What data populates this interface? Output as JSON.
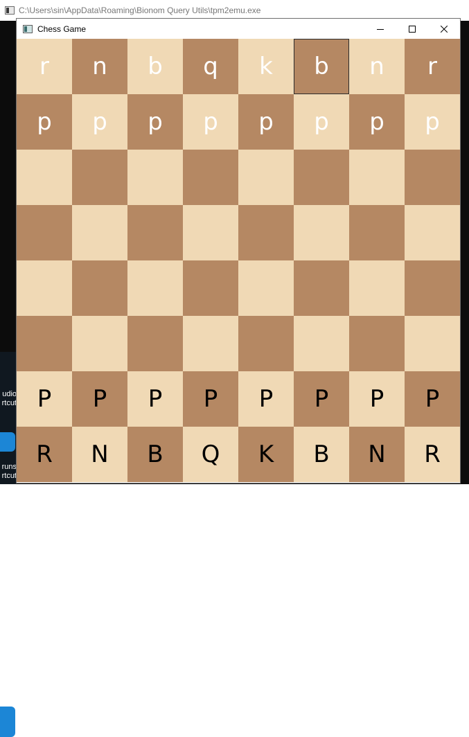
{
  "console": {
    "title": "C:\\Users\\sin\\AppData\\Roaming\\Bionom Query Utils\\tpm2emu.exe"
  },
  "desktop": {
    "icons": [
      {
        "label_line1": "udio",
        "label_line2": "rtcut"
      },
      {
        "label_line1": "runs",
        "label_line2": "rtcut"
      }
    ]
  },
  "window": {
    "title": "Chess Game",
    "icon": "window-app-icon",
    "buttons": {
      "minimize": "minimize-icon",
      "maximize": "maximize-icon",
      "close": "close-icon"
    }
  },
  "board": {
    "light_color": "#f0d9b5",
    "dark_color": "#b58863",
    "selected_square": {
      "row": 0,
      "col": 5
    },
    "rows": [
      [
        "r",
        "n",
        "b",
        "q",
        "k",
        "b",
        "n",
        "r"
      ],
      [
        "p",
        "p",
        "p",
        "p",
        "p",
        "p",
        "p",
        "p"
      ],
      [
        "",
        "",
        "",
        "",
        "",
        "",
        "",
        ""
      ],
      [
        "",
        "",
        "",
        "",
        "",
        "",
        "",
        ""
      ],
      [
        "",
        "",
        "",
        "",
        "",
        "",
        "",
        ""
      ],
      [
        "",
        "",
        "",
        "",
        "",
        "",
        "",
        ""
      ],
      [
        "P",
        "P",
        "P",
        "P",
        "P",
        "P",
        "P",
        "P"
      ],
      [
        "R",
        "N",
        "B",
        "Q",
        "K",
        "B",
        "N",
        "R"
      ]
    ]
  }
}
